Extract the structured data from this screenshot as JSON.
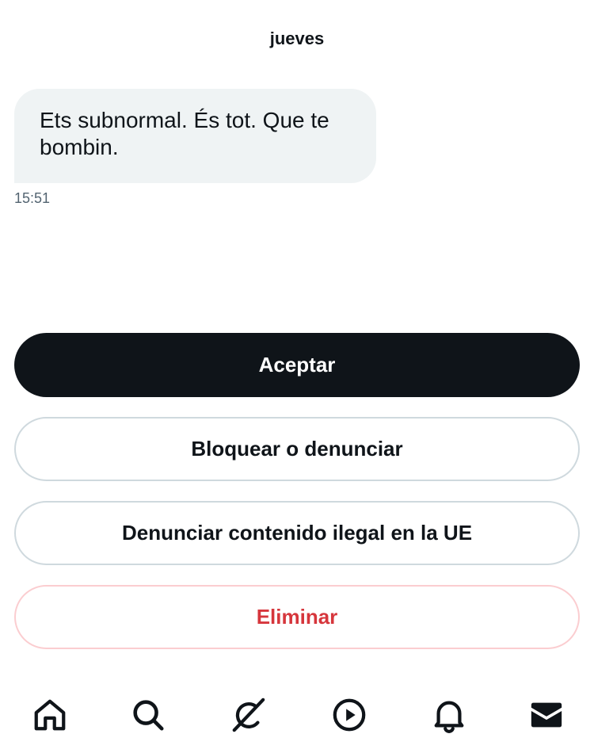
{
  "conversation": {
    "day_label": "jueves",
    "message": {
      "text": "Ets subnormal. És tot. Que te bombin.",
      "time": "15:51"
    }
  },
  "actions": {
    "accept": "Aceptar",
    "block_or_report": "Bloquear o denunciar",
    "report_illegal_eu": "Denunciar contenido ilegal en la UE",
    "delete": "Eliminar"
  },
  "bottom_nav": {
    "items": [
      {
        "icon": "home-icon"
      },
      {
        "icon": "search-icon"
      },
      {
        "icon": "grok-icon"
      },
      {
        "icon": "play-icon"
      },
      {
        "icon": "bell-icon"
      },
      {
        "icon": "mail-icon"
      }
    ]
  },
  "colors": {
    "text_primary": "#0f1419",
    "bubble_bg": "#eff3f4",
    "timestamp": "#536471",
    "danger": "#d6363c",
    "border": "#cfd9de"
  }
}
